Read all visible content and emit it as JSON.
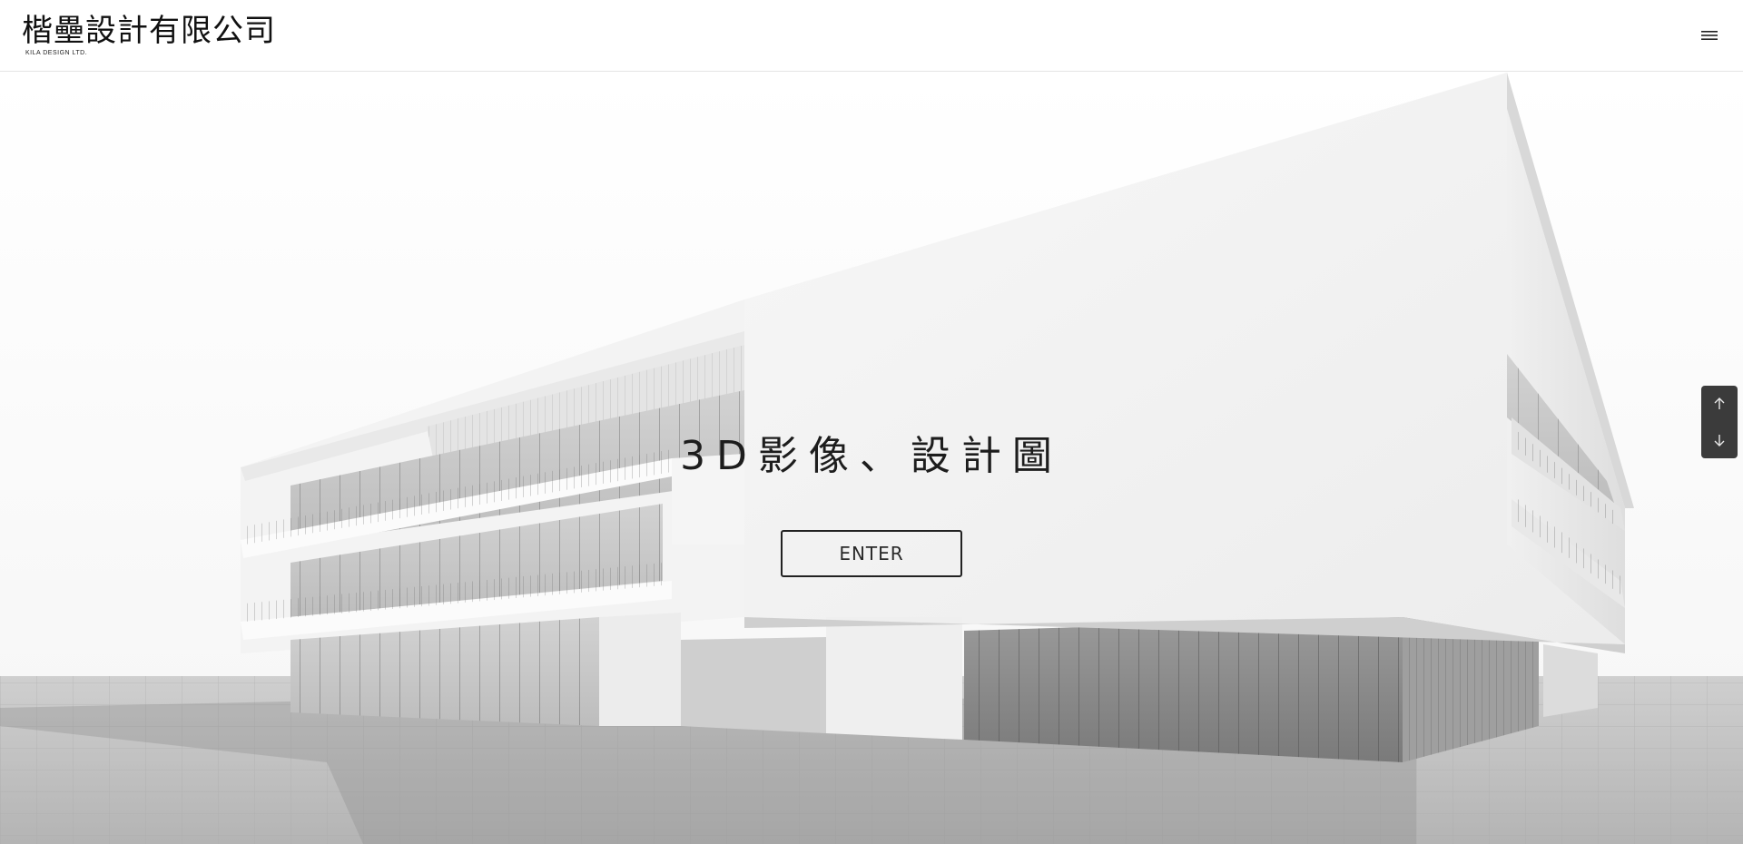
{
  "header": {
    "logo_text": "楷壘設計有限公司",
    "logo_subtitle": "KILA DESIGN LTD.",
    "menu_icon": "hamburger-menu-icon"
  },
  "hero": {
    "title": "3D影像、設計圖",
    "enter_label": "ENTER",
    "image_description_icon": "building-render"
  },
  "scroll_controls": {
    "up_icon": "arrow-up-icon",
    "down_icon": "arrow-down-icon"
  },
  "colors": {
    "header_bg": "#ffffff",
    "text": "#1d1d1d",
    "scroll_widget_bg": "#3b3b3b"
  }
}
